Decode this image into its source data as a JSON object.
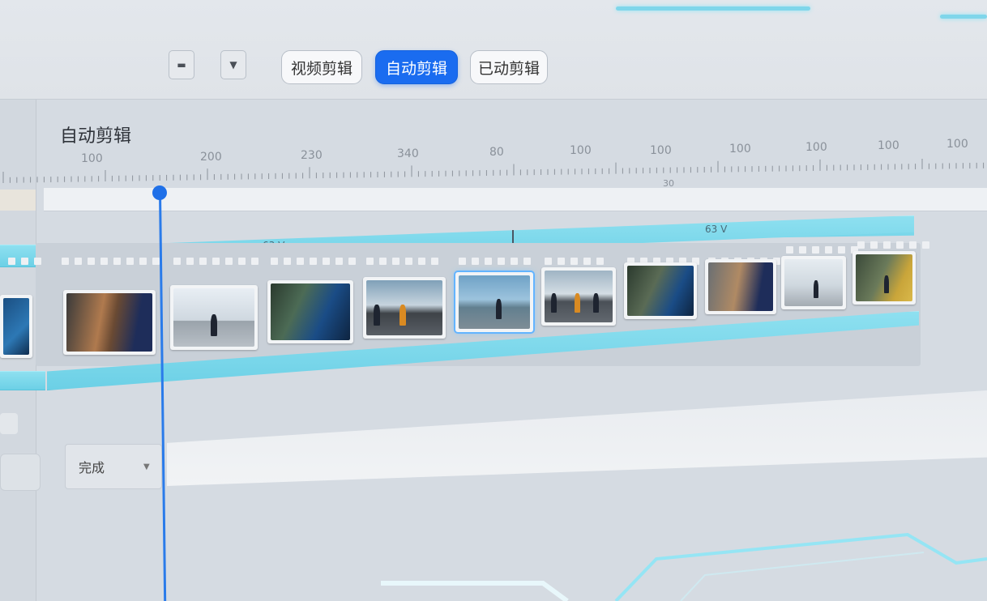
{
  "toolbar": {
    "tabs": [
      {
        "label": "视频剪辑",
        "active": false
      },
      {
        "label": "自动剪辑",
        "active": true
      },
      {
        "label": "已动剪辑",
        "active": false
      }
    ],
    "dropdown_icon": "chevron-down-icon",
    "menu_icon": "menu-icon"
  },
  "panel": {
    "title": "自动剪辑",
    "ruler": {
      "labels": [
        "100",
        "200",
        "230",
        "340",
        "80",
        "100",
        "100",
        "100",
        "100",
        "100",
        "100"
      ],
      "sub_label": "30"
    },
    "track": {
      "label_left": "63 V",
      "label_right": "63 V",
      "start_marker": "0"
    },
    "status_select": "完成"
  },
  "colors": {
    "accent_blue": "#1a6cf0",
    "track_cyan": "#7fd6ea",
    "playhead": "#2a7bea"
  }
}
